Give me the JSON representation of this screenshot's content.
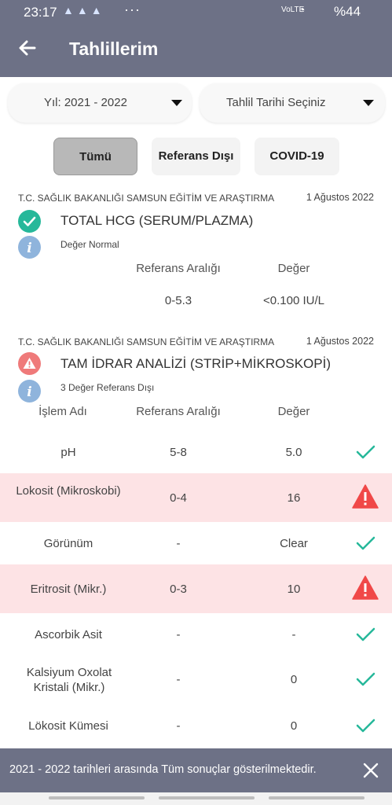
{
  "status_bar": {
    "time": "23:17",
    "notifications": "▲▲▲",
    "more": "···",
    "network": "VoLTE",
    "wifi": "◔",
    "battery": "%44"
  },
  "app_bar": {
    "title": "Tahlillerim",
    "back_icon": "arrow-left-icon"
  },
  "filters": {
    "year": "Yıl: 2021 - 2022",
    "date": "Tahlil Tarihi Seçiniz",
    "buttons": [
      "Tümü",
      "Referans Dışı",
      "COVID-19"
    ],
    "selected": "Tümü"
  },
  "results": [
    {
      "hospital": "T.C. SAĞLIK BAKANLIĞI SAMSUN EĞİTİM VE ARAŞTIRMA",
      "date": "1 Ağustos 2022",
      "name": "TOTAL HCG (SERUM/PLAZMA)",
      "status": "Değer Normal",
      "status_icon": "check-circle-icon",
      "columns": [
        "Referans Aralığı",
        "Değer"
      ],
      "reference": "0-5.3",
      "value": "<0.100 IU/L"
    },
    {
      "hospital": "T.C. SAĞLIK BAKANLIĞI SAMSUN EĞİTİM VE ARAŞTIRMA",
      "date": "1 Ağustos 2022",
      "name": "TAM İDRAR ANALİZİ (STRİP+MİKROSKOPİ)",
      "status": "3 Değer Referans Dışı",
      "status_icon": "warning-circle-icon",
      "columns": [
        "İşlem Adı",
        "Referans Aralığı",
        "Değer"
      ],
      "rows": [
        {
          "name": "pH",
          "reference": "5-8",
          "value": "5.0",
          "flag": "check-icon"
        },
        {
          "name": "Lokosit (Mikroskobi)",
          "reference": "0-4",
          "value": "16",
          "flag": "warning-triangle-icon"
        },
        {
          "name": "Görünüm",
          "reference": "-",
          "value": "Clear",
          "flag": "check-icon"
        },
        {
          "name": "Eritrosit (Mikr.)",
          "reference": "0-3",
          "value": "10",
          "flag": "warning-triangle-icon"
        },
        {
          "name": "Ascorbik Asit",
          "reference": "-",
          "value": "-",
          "flag": "check-icon"
        },
        {
          "name": "Kalsiyum Oxolat Kristali (Mikr.)",
          "reference": "-",
          "value": "0",
          "flag": "check-icon"
        },
        {
          "name": "Lökosit Kümesi",
          "reference": "-",
          "value": "0",
          "flag": "check-icon"
        }
      ]
    }
  ],
  "snackbar": {
    "message": "2021 - 2022 tarihleri arasında Tüm sonuçlar gösterilmektedir."
  },
  "colors": {
    "app_bar": "#6d7186",
    "ok": "#26b89a",
    "alert": "#f04848",
    "alert_row": "#fde3e5",
    "info": "#8fb4dc"
  }
}
